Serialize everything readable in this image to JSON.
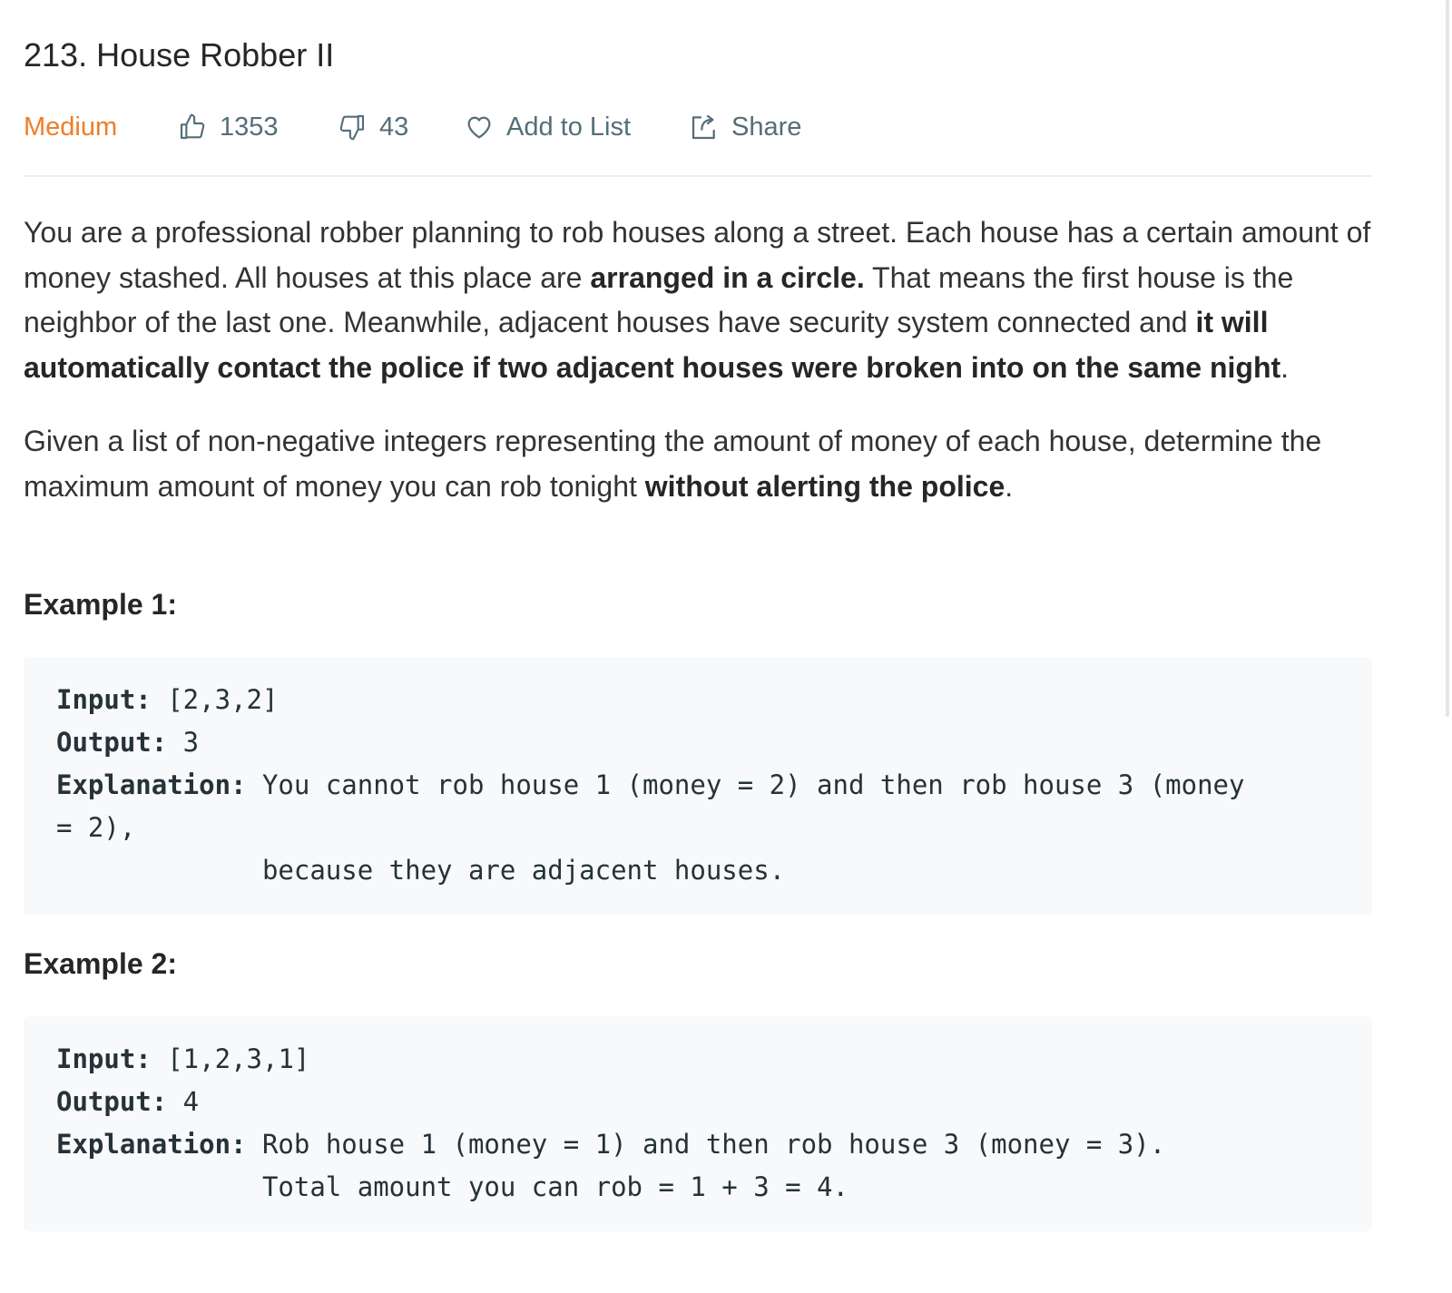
{
  "problem": {
    "title": "213. House Robber II",
    "difficulty": "Medium",
    "likes": "1353",
    "dislikes": "43",
    "add_to_list_label": "Add to List",
    "share_label": "Share"
  },
  "description": {
    "p1": {
      "t1": "You are a professional robber planning to rob houses along a street. Each house has a certain amount of money stashed. All houses at this place are ",
      "b1": "arranged in a circle.",
      "t2": " That means the first house is the neighbor of the last one. Meanwhile, adjacent houses have security system connected and ",
      "b2": "it will automatically contact the police if two adjacent houses were broken into on the same night",
      "t3": "."
    },
    "p2": {
      "t1": "Given a list of non-negative integers representing the amount of money of each house, determine the maximum amount of money you can rob tonight ",
      "b1": "without alerting the police",
      "t2": "."
    }
  },
  "examples": [
    {
      "title": "Example 1:",
      "input_label": "Input:",
      "input_value": " [2,3,2]",
      "output_label": "Output:",
      "output_value": " 3",
      "explanation_label": "Explanation:",
      "explanation_line1": " You cannot rob house 1 (money = 2) and then rob house 3 (money",
      "explanation_line2": "= 2),",
      "explanation_line3": "             because they are adjacent houses."
    },
    {
      "title": "Example 2:",
      "input_label": "Input:",
      "input_value": " [1,2,3,1]",
      "output_label": "Output:",
      "output_value": " 4",
      "explanation_label": "Explanation:",
      "explanation_line1": " Rob house 1 (money = 1) and then rob house 3 (money = 3).",
      "explanation_line2": "             Total amount you can rob = 1 + 3 = 4."
    }
  ],
  "icons": {
    "like": "thumbs-up-icon",
    "dislike": "thumbs-down-icon",
    "favorite": "heart-icon",
    "share": "share-icon"
  },
  "colors": {
    "difficulty_medium": "#ef7d25",
    "meta_text": "#546e7a",
    "code_background": "#f7f9fa"
  }
}
